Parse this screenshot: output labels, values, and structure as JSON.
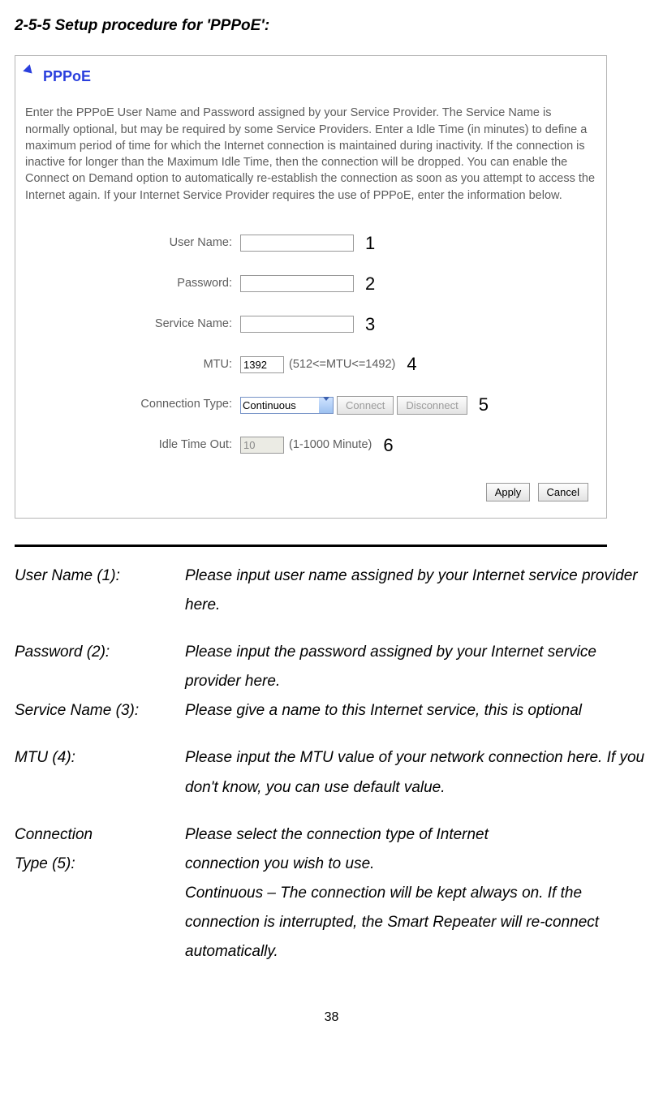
{
  "title": "2-5-5 Setup procedure for 'PPPoE':",
  "panel": {
    "heading": "PPPoE",
    "description": "Enter the PPPoE User Name and Password assigned by your Service Provider. The Service Name is normally optional, but may be required by some Service Providers. Enter a Idle Time (in minutes) to define a maximum period of time for which the Internet connection is maintained during inactivity. If the connection is inactive for longer than the Maximum Idle Time, then the connection will be dropped. You can enable the Connect on Demand option to automatically re-establish the connection as soon as you attempt to access the Internet again. If your Internet Service Provider requires the use of PPPoE, enter the information below.",
    "rows": {
      "username": {
        "label": "User Name:",
        "value": "",
        "annot": "1"
      },
      "password": {
        "label": "Password:",
        "value": "",
        "annot": "2"
      },
      "service": {
        "label": "Service Name:",
        "value": "",
        "annot": "3"
      },
      "mtu": {
        "label": "MTU:",
        "value": "1392",
        "hint": "(512<=MTU<=1492)",
        "annot": "4"
      },
      "conntype": {
        "label": "Connection Type:",
        "value": "Continuous",
        "btn_connect": "Connect",
        "btn_disconnect": "Disconnect",
        "annot": "5"
      },
      "idle": {
        "label": "Idle Time Out:",
        "value": "10",
        "hint": "(1-1000 Minute)",
        "annot": "6"
      }
    },
    "buttons": {
      "apply": "Apply",
      "cancel": "Cancel"
    }
  },
  "defs": [
    {
      "term": "User Name (1):",
      "desc": "Please input user name assigned by your Internet service provider here."
    },
    {
      "term": "",
      "desc": ""
    },
    {
      "term": "Password (2):",
      "desc": "Please input the password assigned by your Internet service provider here."
    },
    {
      "term": "Service Name (3):",
      "desc": "Please give a name to this Internet service, this is optional"
    },
    {
      "term": "",
      "desc": ""
    },
    {
      "term": "MTU (4):",
      "desc": "Please input the MTU value of your network connection here. If you don't know, you can use default value."
    },
    {
      "term": "",
      "desc": ""
    },
    {
      "term": "Connection",
      "desc": "Please select the connection type of Internet"
    },
    {
      "term": "Type (5):",
      "desc": "connection you wish to use."
    },
    {
      "term": "",
      "desc": "Continuous – The connection will be kept always on. If the connection is interrupted, the Smart Repeater will re-connect automatically."
    }
  ],
  "page_number": "38"
}
